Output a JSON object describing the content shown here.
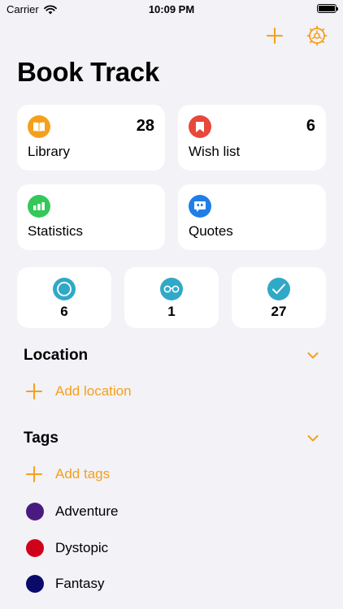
{
  "status_bar": {
    "carrier": "Carrier",
    "time": "10:09 PM"
  },
  "header": {
    "title": "Book Track"
  },
  "colors": {
    "accent": "#f5a01a",
    "library": "#f5a01a",
    "wishlist": "#e8473b",
    "statistics": "#34c759",
    "quotes": "#1f7ee8",
    "status": "#30a9c7"
  },
  "cards": {
    "library": {
      "label": "Library",
      "count": "28",
      "icon": "book-icon"
    },
    "wishlist": {
      "label": "Wish list",
      "count": "6",
      "icon": "bookmark-icon"
    },
    "statistics": {
      "label": "Statistics",
      "icon": "bar-chart-icon"
    },
    "quotes": {
      "label": "Quotes",
      "icon": "quote-bubble-icon"
    }
  },
  "status_counts": {
    "to_read": {
      "value": "6",
      "icon": "circle-icon"
    },
    "reading": {
      "value": "1",
      "icon": "glasses-icon"
    },
    "finished": {
      "value": "27",
      "icon": "checkmark-icon"
    }
  },
  "location": {
    "title": "Location",
    "add_label": "Add location"
  },
  "tags": {
    "title": "Tags",
    "add_label": "Add tags",
    "items": [
      {
        "name": "Adventure",
        "color": "#4b1a80"
      },
      {
        "name": "Dystopic",
        "color": "#d0021b"
      },
      {
        "name": "Fantasy",
        "color": "#0a0a6b"
      }
    ]
  }
}
